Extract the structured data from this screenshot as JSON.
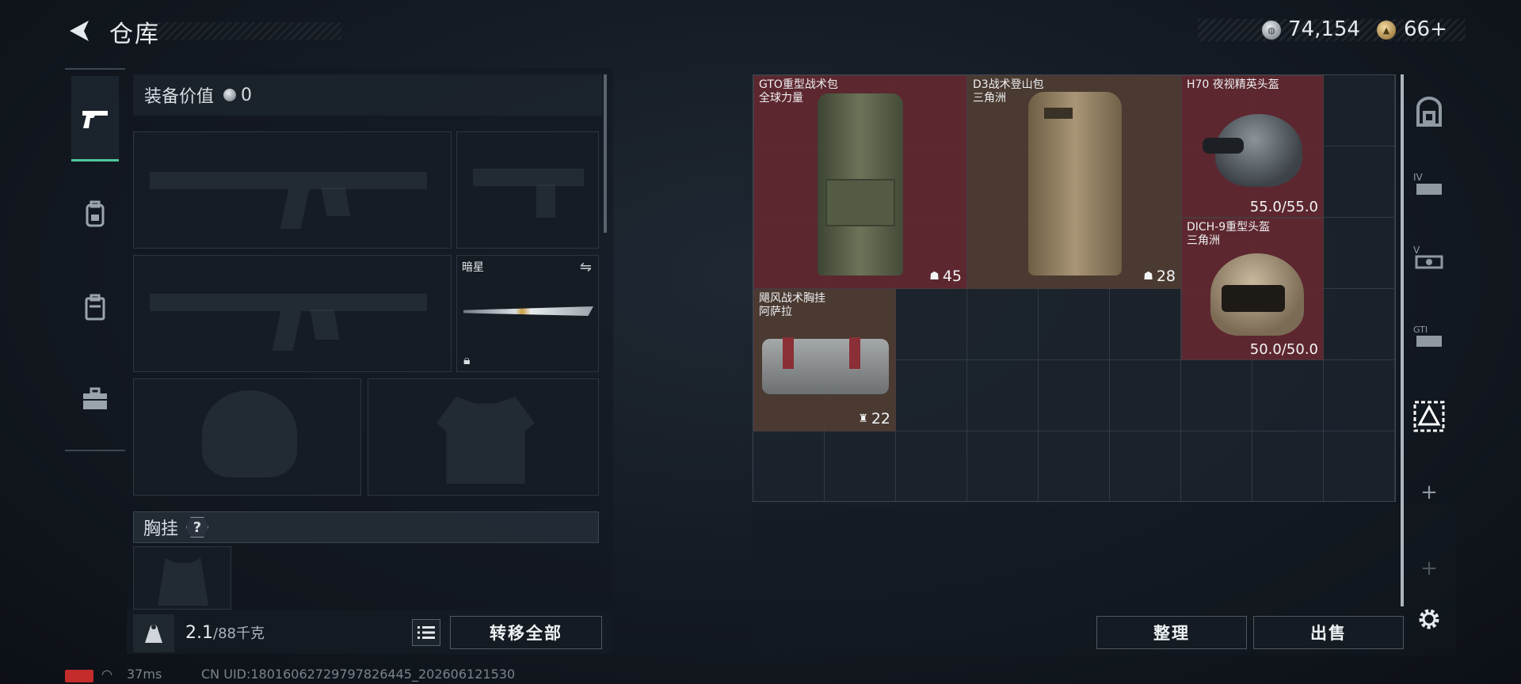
{
  "header": {
    "title": "仓库"
  },
  "currency": {
    "silver": "74,154",
    "gold": "66+"
  },
  "equipment": {
    "value_label": "装备价值",
    "value": "0",
    "knife_name": "暗星",
    "chest_label": "胸挂",
    "chest_help": "?"
  },
  "capacity": {
    "current": "2.1",
    "max": "/88千克"
  },
  "buttons": {
    "transfer_all": "转移全部",
    "organize": "整理",
    "sell": "出售"
  },
  "status": {
    "ping": "37ms",
    "uid": "CN UID:1801606272979782644​5_202606121530"
  },
  "stash_items": [
    {
      "name": "GTO重型战术包\n全球力量",
      "capacity": "45",
      "color": "red"
    },
    {
      "name": "D3战术登山包\n三角洲",
      "capacity": "28",
      "color": "brown"
    },
    {
      "name": "H70 夜视精英头盔",
      "durability": "55.0/55.0",
      "color": "red"
    },
    {
      "name": "DICH-9重型头盔\n三角洲",
      "durability": "50.0/50.0",
      "color": "red"
    },
    {
      "name": "飓风战术胸挂\n阿萨拉",
      "capacity": "22",
      "color": "brown"
    }
  ],
  "colors": {
    "accent": "#4fc79e",
    "rare_red": "#682830",
    "brown": "#523e32"
  }
}
